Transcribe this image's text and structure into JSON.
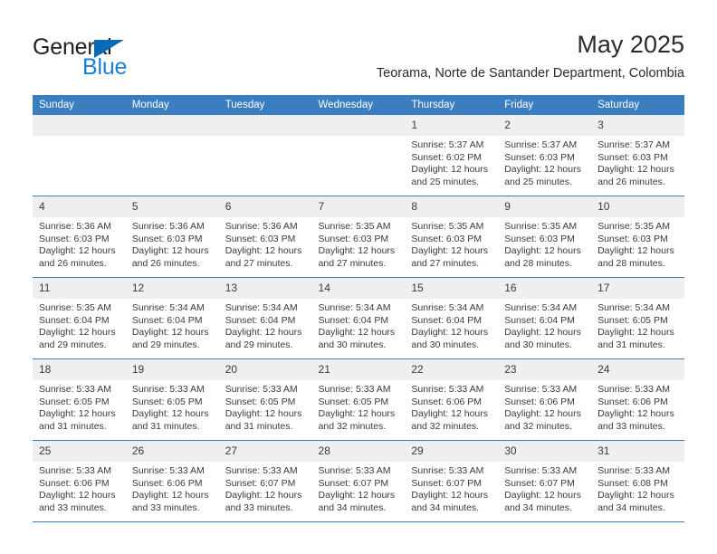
{
  "brand": {
    "name_part1": "General",
    "name_part2": "Blue",
    "accent_color": "#1a7fd4",
    "triangle_color": "#0a6ab5"
  },
  "header": {
    "title": "May 2025",
    "subtitle": "Teorama, Norte de Santander Department, Colombia"
  },
  "calendar": {
    "header_background": "#3a7ebf",
    "daynum_background": "#efefef",
    "weekday_headers": [
      "Sunday",
      "Monday",
      "Tuesday",
      "Wednesday",
      "Thursday",
      "Friday",
      "Saturday"
    ],
    "weeks": [
      [
        {
          "day": "",
          "empty": true
        },
        {
          "day": "",
          "empty": true
        },
        {
          "day": "",
          "empty": true
        },
        {
          "day": "",
          "empty": true
        },
        {
          "day": "1",
          "sunrise": "Sunrise: 5:37 AM",
          "sunset": "Sunset: 6:02 PM",
          "daylight": "Daylight: 12 hours and 25 minutes."
        },
        {
          "day": "2",
          "sunrise": "Sunrise: 5:37 AM",
          "sunset": "Sunset: 6:03 PM",
          "daylight": "Daylight: 12 hours and 25 minutes."
        },
        {
          "day": "3",
          "sunrise": "Sunrise: 5:37 AM",
          "sunset": "Sunset: 6:03 PM",
          "daylight": "Daylight: 12 hours and 26 minutes."
        }
      ],
      [
        {
          "day": "4",
          "sunrise": "Sunrise: 5:36 AM",
          "sunset": "Sunset: 6:03 PM",
          "daylight": "Daylight: 12 hours and 26 minutes."
        },
        {
          "day": "5",
          "sunrise": "Sunrise: 5:36 AM",
          "sunset": "Sunset: 6:03 PM",
          "daylight": "Daylight: 12 hours and 26 minutes."
        },
        {
          "day": "6",
          "sunrise": "Sunrise: 5:36 AM",
          "sunset": "Sunset: 6:03 PM",
          "daylight": "Daylight: 12 hours and 27 minutes."
        },
        {
          "day": "7",
          "sunrise": "Sunrise: 5:35 AM",
          "sunset": "Sunset: 6:03 PM",
          "daylight": "Daylight: 12 hours and 27 minutes."
        },
        {
          "day": "8",
          "sunrise": "Sunrise: 5:35 AM",
          "sunset": "Sunset: 6:03 PM",
          "daylight": "Daylight: 12 hours and 27 minutes."
        },
        {
          "day": "9",
          "sunrise": "Sunrise: 5:35 AM",
          "sunset": "Sunset: 6:03 PM",
          "daylight": "Daylight: 12 hours and 28 minutes."
        },
        {
          "day": "10",
          "sunrise": "Sunrise: 5:35 AM",
          "sunset": "Sunset: 6:03 PM",
          "daylight": "Daylight: 12 hours and 28 minutes."
        }
      ],
      [
        {
          "day": "11",
          "sunrise": "Sunrise: 5:35 AM",
          "sunset": "Sunset: 6:04 PM",
          "daylight": "Daylight: 12 hours and 29 minutes."
        },
        {
          "day": "12",
          "sunrise": "Sunrise: 5:34 AM",
          "sunset": "Sunset: 6:04 PM",
          "daylight": "Daylight: 12 hours and 29 minutes."
        },
        {
          "day": "13",
          "sunrise": "Sunrise: 5:34 AM",
          "sunset": "Sunset: 6:04 PM",
          "daylight": "Daylight: 12 hours and 29 minutes."
        },
        {
          "day": "14",
          "sunrise": "Sunrise: 5:34 AM",
          "sunset": "Sunset: 6:04 PM",
          "daylight": "Daylight: 12 hours and 30 minutes."
        },
        {
          "day": "15",
          "sunrise": "Sunrise: 5:34 AM",
          "sunset": "Sunset: 6:04 PM",
          "daylight": "Daylight: 12 hours and 30 minutes."
        },
        {
          "day": "16",
          "sunrise": "Sunrise: 5:34 AM",
          "sunset": "Sunset: 6:04 PM",
          "daylight": "Daylight: 12 hours and 30 minutes."
        },
        {
          "day": "17",
          "sunrise": "Sunrise: 5:34 AM",
          "sunset": "Sunset: 6:05 PM",
          "daylight": "Daylight: 12 hours and 31 minutes."
        }
      ],
      [
        {
          "day": "18",
          "sunrise": "Sunrise: 5:33 AM",
          "sunset": "Sunset: 6:05 PM",
          "daylight": "Daylight: 12 hours and 31 minutes."
        },
        {
          "day": "19",
          "sunrise": "Sunrise: 5:33 AM",
          "sunset": "Sunset: 6:05 PM",
          "daylight": "Daylight: 12 hours and 31 minutes."
        },
        {
          "day": "20",
          "sunrise": "Sunrise: 5:33 AM",
          "sunset": "Sunset: 6:05 PM",
          "daylight": "Daylight: 12 hours and 31 minutes."
        },
        {
          "day": "21",
          "sunrise": "Sunrise: 5:33 AM",
          "sunset": "Sunset: 6:05 PM",
          "daylight": "Daylight: 12 hours and 32 minutes."
        },
        {
          "day": "22",
          "sunrise": "Sunrise: 5:33 AM",
          "sunset": "Sunset: 6:06 PM",
          "daylight": "Daylight: 12 hours and 32 minutes."
        },
        {
          "day": "23",
          "sunrise": "Sunrise: 5:33 AM",
          "sunset": "Sunset: 6:06 PM",
          "daylight": "Daylight: 12 hours and 32 minutes."
        },
        {
          "day": "24",
          "sunrise": "Sunrise: 5:33 AM",
          "sunset": "Sunset: 6:06 PM",
          "daylight": "Daylight: 12 hours and 33 minutes."
        }
      ],
      [
        {
          "day": "25",
          "sunrise": "Sunrise: 5:33 AM",
          "sunset": "Sunset: 6:06 PM",
          "daylight": "Daylight: 12 hours and 33 minutes."
        },
        {
          "day": "26",
          "sunrise": "Sunrise: 5:33 AM",
          "sunset": "Sunset: 6:06 PM",
          "daylight": "Daylight: 12 hours and 33 minutes."
        },
        {
          "day": "27",
          "sunrise": "Sunrise: 5:33 AM",
          "sunset": "Sunset: 6:07 PM",
          "daylight": "Daylight: 12 hours and 33 minutes."
        },
        {
          "day": "28",
          "sunrise": "Sunrise: 5:33 AM",
          "sunset": "Sunset: 6:07 PM",
          "daylight": "Daylight: 12 hours and 34 minutes."
        },
        {
          "day": "29",
          "sunrise": "Sunrise: 5:33 AM",
          "sunset": "Sunset: 6:07 PM",
          "daylight": "Daylight: 12 hours and 34 minutes."
        },
        {
          "day": "30",
          "sunrise": "Sunrise: 5:33 AM",
          "sunset": "Sunset: 6:07 PM",
          "daylight": "Daylight: 12 hours and 34 minutes."
        },
        {
          "day": "31",
          "sunrise": "Sunrise: 5:33 AM",
          "sunset": "Sunset: 6:08 PM",
          "daylight": "Daylight: 12 hours and 34 minutes."
        }
      ]
    ]
  }
}
